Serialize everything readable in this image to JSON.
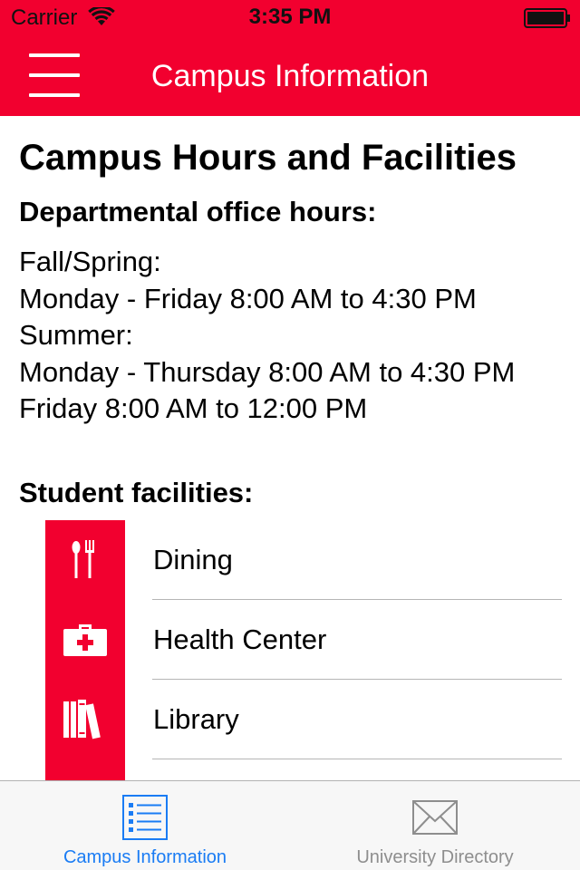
{
  "status_bar": {
    "carrier": "Carrier",
    "time": "3:35 PM"
  },
  "colors": {
    "brand": "#f2002f",
    "tab_active": "#1a7cf4",
    "tab_inactive": "#8e8e8e"
  },
  "navbar": {
    "title": "Campus Information",
    "menu_icon": "hamburger-menu-icon"
  },
  "content": {
    "title": "Campus Hours and Facilities",
    "office_hours_heading": "Departmental office hours:",
    "hours_lines": [
      "Fall/Spring:",
      "Monday - Friday 8:00 AM to 4:30 PM",
      "Summer:",
      "Monday - Thursday 8:00 AM to 4:30 PM",
      "Friday 8:00 AM to 12:00 PM"
    ],
    "facilities_heading": "Student facilities:",
    "facilities": [
      {
        "label": "Dining",
        "icon": "dining-utensils-icon"
      },
      {
        "label": "Health Center",
        "icon": "first-aid-kit-icon"
      },
      {
        "label": "Library",
        "icon": "books-icon"
      },
      {
        "label": "",
        "icon": "facility-icon"
      }
    ]
  },
  "tabbar": {
    "tabs": [
      {
        "label": "Campus Information",
        "icon": "list-icon",
        "selected": true
      },
      {
        "label": "University Directory",
        "icon": "envelope-icon",
        "selected": false
      }
    ]
  }
}
